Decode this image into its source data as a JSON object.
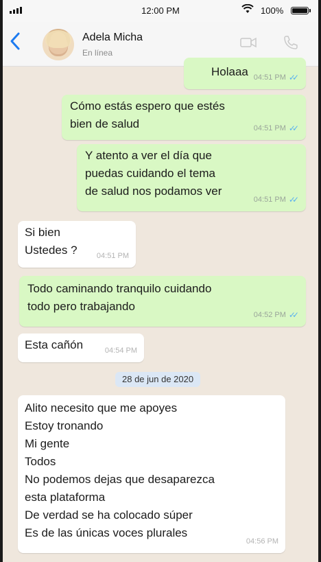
{
  "status_bar": {
    "time": "12:00 PM",
    "battery": "100%"
  },
  "header": {
    "contact_name": "Adela Micha",
    "contact_status": "En línea"
  },
  "messages": [
    {
      "text": "Holaaa",
      "time": "04:51 PM"
    },
    {
      "text": "Cómo estás espero que estés\nbien de salud",
      "time": "04:51 PM"
    },
    {
      "text": "Y atento a ver el día que\npuedas cuidando el tema\nde salud nos podamos ver",
      "time": "04:51 PM"
    },
    {
      "text": "Si bien\nUstedes ?",
      "time": "04:51 PM"
    },
    {
      "text": "Todo caminando tranquilo cuidando\ntodo pero trabajando",
      "time": "04:52 PM"
    },
    {
      "text": "Esta cañón",
      "time": "04:54 PM"
    },
    {
      "text": "Alito necesito que me apoyes\nEstoy tronando\nMi gente\nTodos\nNo podemos dejas que desaparezca\nesta plataforma\nDe verdad se ha colocado súper\nEs de las únicas voces plurales",
      "time": "04:56 PM"
    }
  ],
  "date_separator": "28 de jun de 2020",
  "ticks": "✓✓",
  "colors": {
    "outgoing": "#d9f8c4",
    "incoming": "#ffffff",
    "accent": "#1d7bf0",
    "read_ticks": "#58b0f0"
  }
}
